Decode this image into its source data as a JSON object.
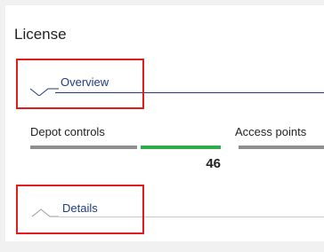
{
  "panel": {
    "title": "License"
  },
  "sections": {
    "overview": {
      "label": "Overview",
      "state": "expanded",
      "accent": "#1f3b82"
    },
    "details": {
      "label": "Details",
      "state": "collapsed",
      "accent": "#1f3b82"
    }
  },
  "metrics": [
    {
      "label": "Depot controls",
      "value": "46",
      "bar_color": "#2eac4b"
    },
    {
      "label": "Access points"
    }
  ],
  "colors": {
    "highlight": "#e21b1b",
    "bar_neutral": "#8f8f8f"
  }
}
